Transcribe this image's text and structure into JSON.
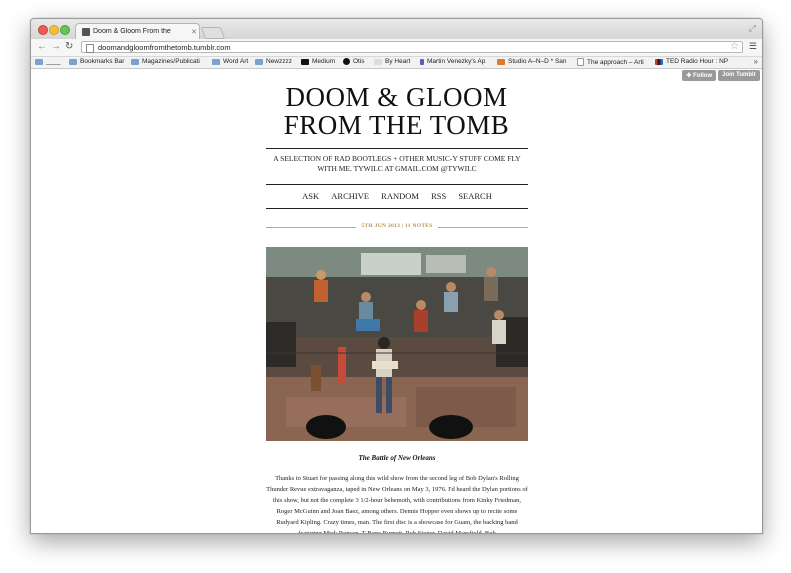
{
  "browser": {
    "tab_title": "Doom & Gloom From the",
    "url": "doomandgloomfromthetomb.tumblr.com"
  },
  "bookmarks": [
    {
      "label": "____",
      "icon": "folder-icon"
    },
    {
      "label": "Bookmarks Bar",
      "icon": "folder-icon"
    },
    {
      "label": "Magazines/Publicati",
      "icon": "folder-icon"
    },
    {
      "label": "Word Art",
      "icon": "folder-icon"
    },
    {
      "label": "Newzzzz",
      "icon": "folder-icon"
    },
    {
      "label": "Medium",
      "icon": "medium-icon"
    },
    {
      "label": "Otis",
      "icon": "otis-icon"
    },
    {
      "label": "By Heart",
      "icon": "heart-icon"
    },
    {
      "label": "Martin Venezky's Ap",
      "icon": "figure-icon"
    },
    {
      "label": "Studio A–N–D * San",
      "icon": "studio-icon"
    },
    {
      "label": "The approach – Arti",
      "icon": "page-icon"
    },
    {
      "label": "TED Radio Hour : NP",
      "icon": "npr-icon"
    }
  ],
  "tumblr": {
    "follow": "Follow",
    "join": "Join Tumblr"
  },
  "blog": {
    "title": "DOOM & GLOOM\nFROM THE TOMB",
    "description": "A SELECTION OF RAD BOOTLEGS + OTHER MUSIC-Y STUFF COME FLY WITH ME. TYWILC AT GMAIL.COM @TYWILC",
    "nav": [
      "ASK",
      "ARCHIVE",
      "RANDOM",
      "RSS",
      "SEARCH"
    ]
  },
  "post": {
    "meta": "5TH JUN 2013 | 11 NOTES",
    "caption": "The Battle of New Orleans",
    "body": "Thanks to Stuart for passing along this wild show from the second leg of Bob Dylan's Rolling Thunder Revue extravaganza, taped in New Orleans on May 3, 1976. I'd heard the Dylan portions of this show, but not the complete 3 1/2-hour behemoth, with contributions from Kinky Friedman, Roger McGuinn and Joan Baez, among others. Dennis Hopper even shows up to recite some Rudyard Kipling. Crazy times, man. The first disc is a showcase for Guam, the backing band featuring Mick Ronson, T-Bone Burnett, Rob Stoner, David Mansfield, Bob"
  },
  "colors": {
    "accent_gold": "#b0904e",
    "tumblr_button": "#9a9a9a"
  }
}
